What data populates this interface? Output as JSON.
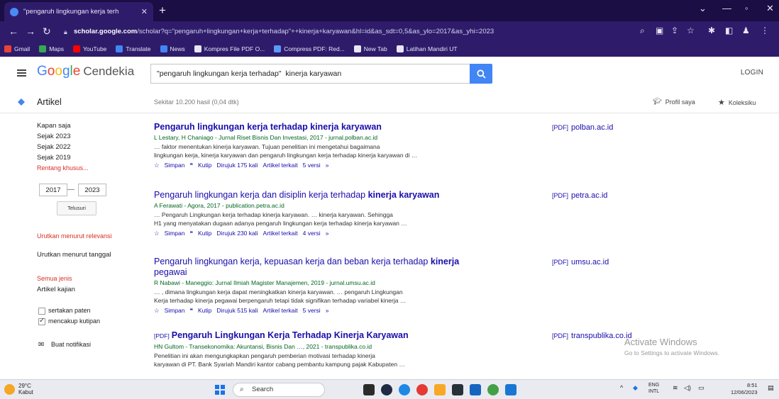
{
  "browser": {
    "tab_title": "\"pengaruh lingkungan kerja terh",
    "url_host": "scholar.google.com",
    "url_path": "/scholar?q=\"pengaruh+lingkungan+kerja+terhadap\"++kinerja+karyawan&hl=id&as_sdt=0,5&as_ylo=2017&as_yhi=2023",
    "bookmarks": [
      {
        "label": "Gmail",
        "color": "#ea4335"
      },
      {
        "label": "Maps",
        "color": "#34a853"
      },
      {
        "label": "YouTube",
        "color": "#ff0000"
      },
      {
        "label": "Translate",
        "color": "#4285f4"
      },
      {
        "label": "News",
        "color": "#4285f4"
      },
      {
        "label": "Kompres File PDF O...",
        "color": "#e8e6f5"
      },
      {
        "label": "Compress PDF: Red...",
        "color": "#5b9bf8"
      },
      {
        "label": "New Tab",
        "color": "#e8e6f5"
      },
      {
        "label": "Latihan Mandiri UT",
        "color": "#e8e6f5"
      }
    ]
  },
  "header": {
    "logo_google": "Google",
    "logo_product": "Cendekia",
    "search_value": "\"pengaruh lingkungan kerja terhadap\"  kinerja karyawan",
    "login_label": "LOGIN"
  },
  "subheader": {
    "artikel_label": "Artikel",
    "result_count": "Sekitar 10.200 hasil (0,04 dtk)",
    "profile_label": "Profil saya",
    "koleksi_label": "Koleksiku"
  },
  "filters": {
    "time": [
      "Kapan saja",
      "Sejak 2023",
      "Sejak 2022",
      "Sejak 2019"
    ],
    "custom_range": "Rentang khusus...",
    "year_from": "2017",
    "year_to": "2023",
    "search_btn": "Telusuri",
    "sort_relevance": "Urutkan menurut relevansi",
    "sort_date": "Urutkan menurut tanggal",
    "all_types": "Semua jenis",
    "review_articles": "Artikel kajian",
    "include_patents": "sertakan paten",
    "include_citations": "mencakup kutipan",
    "alert_label": "Buat notifikasi"
  },
  "results": [
    {
      "title_plain": "",
      "title_bold": "Pengaruh lingkungan kerja terhadap kinerja karyawan",
      "prefix": "",
      "meta": "L Lestary, H Chaniago - Jurnal Riset Bisnis Dan Investasi, 2017 - jurnal.polban.ac.id",
      "snip1": "… faktor menentukan kinerja karyawan. Tujuan penelitian ini mengetahui bagaimana",
      "snip2": "lingkungan kerja, kinerja karyawan dan pengaruh lingkungan kerja terhadap kinerja karyawan di …",
      "cited": "Dirujuk 175 kali",
      "versions": "5 versi",
      "pdf": "polban.ac.id"
    },
    {
      "title_plain": "Pengaruh lingkungan kerja dan disiplin kerja terhadap ",
      "title_bold": "kinerja karyawan",
      "prefix": "",
      "meta": "A Ferawati - Agora, 2017 - publication.petra.ac.id",
      "snip1": "… Pengaruh Lingkungan kerja terhadap kinerja karyawan. … kinerja karyawan. Sehingga",
      "snip2": "H1 yang menyatakan dugaan adanya pengaruh lingkungan kerja terhadap kinerja karyawan …",
      "cited": "Dirujuk 230 kali",
      "versions": "4 versi",
      "pdf": "petra.ac.id"
    },
    {
      "title_plain": "Pengaruh lingkungan kerja, kepuasan kerja dan beban kerja terhadap ",
      "title_bold": "kinerja",
      "title_line2": "pegawai",
      "prefix": "",
      "meta": "R Nabawi - Maneggio: Jurnal Ilmiah Magister Manajemen, 2019 - jurnal.umsu.ac.id",
      "snip1": "… , dimana lingkungan kerja dapat meningkatkan kinerja karyawan. … pengaruh Lingkungan",
      "snip2": "Kerja terhadap kinerja pegawai berpengaruh tetapi tidak signifikan terhadap variabel kinerja …",
      "cited": "Dirujuk 515 kali",
      "versions": "5 versi",
      "pdf": "umsu.ac.id"
    },
    {
      "title_plain": "",
      "title_bold": "Pengaruh Lingkungan Kerja Terhadap Kinerja Karyawan",
      "prefix": "[PDF]",
      "meta": "HN Gultom - Transekonomika: Akuntansi, Bisnis Dan …, 2021 - transpublika.co.id",
      "snip1": "Penelitian ini akan mengungkapkan pengaruh pemberian motivasi terhadap kinerja",
      "snip2": "karyawan di PT. Bank Syariah Mandiri kantor cabang pembantu kampung pajak Kabupaten …",
      "cited": "",
      "versions": "",
      "pdf": "transpublika.co.id"
    }
  ],
  "result_actions": {
    "save": "Simpan",
    "cite": "Kutip",
    "related": "Artikel terkait",
    "more": "»",
    "pdf_tag": "[PDF]"
  },
  "watermark": {
    "line1": "Activate Windows",
    "line2": "Go to Settings to activate Windows."
  },
  "taskbar": {
    "temp": "29°C",
    "weather": "Kabut",
    "search_label": "Search",
    "lang1": "ENG",
    "lang2": "INTL",
    "time": "8:51",
    "date": "12/06/2023"
  }
}
